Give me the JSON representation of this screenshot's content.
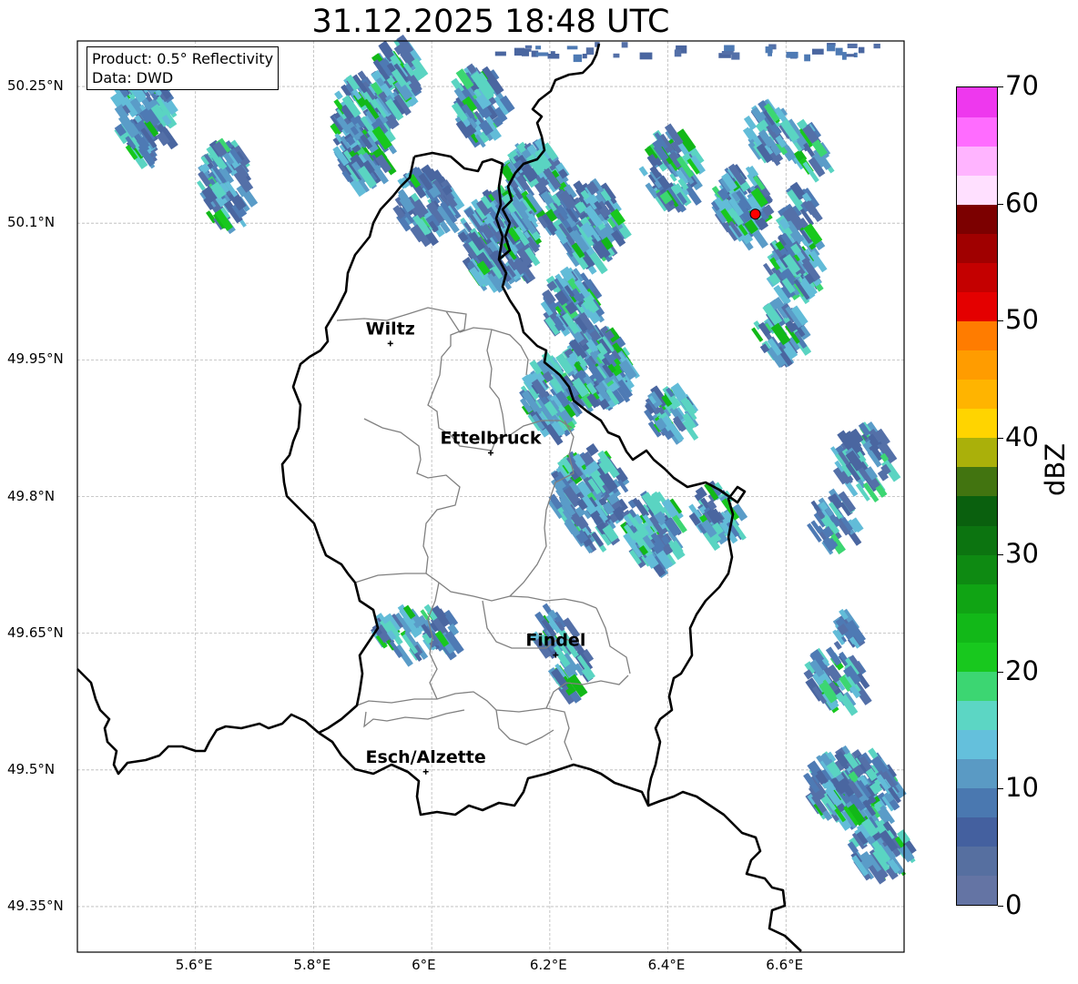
{
  "title": "31.12.2025 18:48 UTC",
  "info": {
    "product": "Product: 0.5° Reflectivity",
    "data": "Data: DWD"
  },
  "lat_ticks": [
    {
      "lat": 50.25,
      "label": "50.25°N"
    },
    {
      "lat": 50.1,
      "label": "50.1°N"
    },
    {
      "lat": 49.95,
      "label": "49.95°N"
    },
    {
      "lat": 49.8,
      "label": "49.8°N"
    },
    {
      "lat": 49.65,
      "label": "49.65°N"
    },
    {
      "lat": 49.5,
      "label": "49.5°N"
    },
    {
      "lat": 49.35,
      "label": "49.35°N"
    }
  ],
  "lon_ticks": [
    {
      "lon": 5.6,
      "label": "5.6°E"
    },
    {
      "lon": 5.8,
      "label": "5.8°E"
    },
    {
      "lon": 6.0,
      "label": "6°E"
    },
    {
      "lon": 6.2,
      "label": "6.2°E"
    },
    {
      "lon": 6.4,
      "label": "6.4°E"
    },
    {
      "lon": 6.6,
      "label": "6.6°E"
    }
  ],
  "extent": {
    "lon_min": 5.4,
    "lon_max": 6.8,
    "lat_min": 49.3,
    "lat_max": 50.3
  },
  "cities": [
    {
      "name": "Wiltz",
      "lon": 5.93,
      "lat": 49.968
    },
    {
      "name": "Ettelbruck",
      "lon": 6.1,
      "lat": 49.848
    },
    {
      "name": "Findel",
      "lon": 6.21,
      "lat": 49.626
    },
    {
      "name": "Esch/Alzette",
      "lon": 5.99,
      "lat": 49.498
    }
  ],
  "radar_site": {
    "lon": 6.548,
    "lat": 50.11
  },
  "colorbar": {
    "label": "dBZ",
    "min": 0,
    "max": 70,
    "ticks": [
      0,
      10,
      20,
      30,
      40,
      50,
      60,
      70
    ],
    "colors": [
      "#6474a4",
      "#566fa0",
      "#44609f",
      "#4a78b0",
      "#5a9ac4",
      "#64c0dc",
      "#5cd6c4",
      "#3cd672",
      "#18c81e",
      "#12b818",
      "#10a414",
      "#0e8a12",
      "#0c7410",
      "#0a600e",
      "#427410",
      "#aab00a",
      "#ffd400",
      "#ffb400",
      "#ff9c00",
      "#ff7c00",
      "#e40000",
      "#c40000",
      "#a00000",
      "#7c0000",
      "#ffe0ff",
      "#ffb4ff",
      "#ff6cff",
      "#ee38ee"
    ]
  },
  "colors": {
    "border": "#000000",
    "canton_border": "#808080",
    "grid": "#b8b8b8",
    "radar_site": "#ff0000"
  }
}
